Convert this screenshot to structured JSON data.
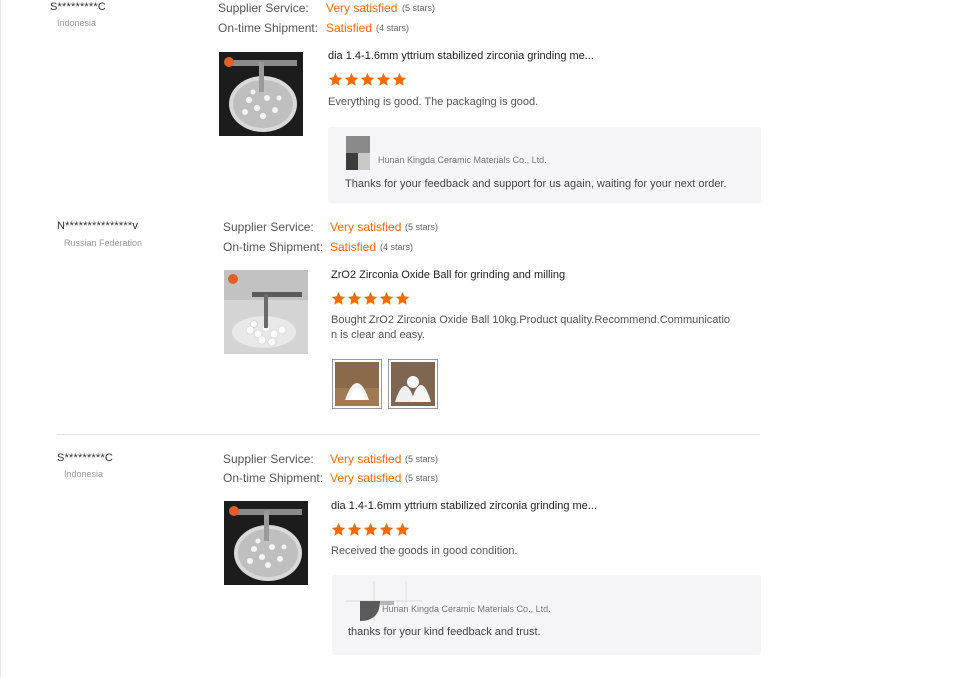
{
  "reviews": [
    {
      "buyer": "S*********C",
      "country": "Indonesia",
      "supplier_service_label": "Supplier Service:",
      "supplier_service_value": "Very satisfied",
      "supplier_service_stars": "(5 stars)",
      "shipment_label": "On-time Shipment:",
      "shipment_value": "Satisfied",
      "shipment_stars": "(4 stars)",
      "product_title": "dia 1.4-1.6mm yttrium stabilized zirconia grinding me...",
      "rating": 5,
      "text": "Everything is good. The packaging is good.",
      "reply": {
        "company": "Hunan Kingda Ceramic Materials Co., Ltd.",
        "text": "Thanks for your feedback and support for us again, waiting for your next order."
      }
    },
    {
      "buyer": "N***************v",
      "country": "Russian Federation",
      "supplier_service_label": "Supplier Service:",
      "supplier_service_value": "Very satisfied",
      "supplier_service_stars": "(5 stars)",
      "shipment_label": "On-time Shipment:",
      "shipment_value": "Satisfied",
      "shipment_stars": "(4 stars)",
      "product_title": "ZrO2 Zirconia Oxide Ball for grinding and milling",
      "rating": 5,
      "text_line1": "Bought ZrO2 Zirconia Oxide Ball 10kg.Product quality.Recommend.Communicatio",
      "text_line2": "n is clear and easy.",
      "photos": 2
    },
    {
      "buyer": "S*********C",
      "country": "Indonesia",
      "supplier_service_label": "Supplier Service:",
      "supplier_service_value": "Very satisfied",
      "supplier_service_stars": "(5 stars)",
      "shipment_label": "On-time Shipment:",
      "shipment_value": "Very satisfied",
      "shipment_stars": "(5 stars)",
      "product_title": "dia 1.4-1.6mm yttrium stabilized zirconia grinding me...",
      "rating": 5,
      "text": "Received the goods in good condition.",
      "reply": {
        "company": "Hunan Kingda Ceramic Materials Co., Ltd.",
        "text": "thanks for your kind feedback and trust."
      }
    }
  ],
  "colors": {
    "accent": "#ff6a00",
    "reply_bg": "#f5f5f7",
    "divider": "#e3e3e3"
  },
  "icons": {
    "star": "star-icon",
    "company_logo": "company-logo-icon"
  }
}
